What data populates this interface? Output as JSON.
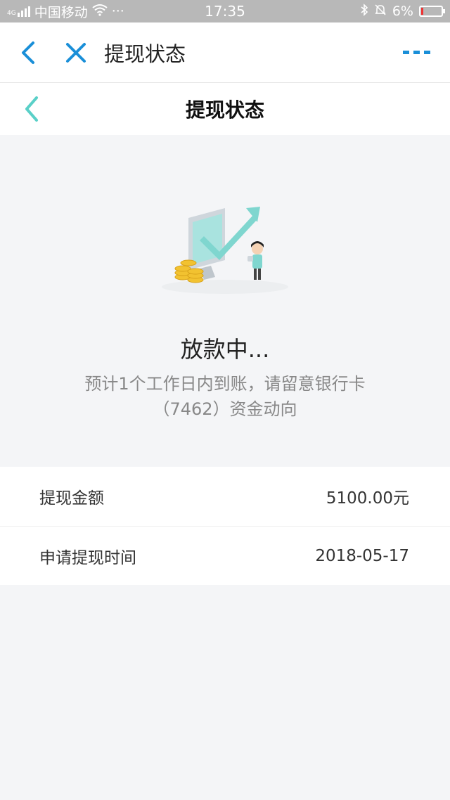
{
  "status_bar": {
    "carrier": "中国移动",
    "signal_label": "4G",
    "dots": "···",
    "time": "17:35",
    "battery": "6%"
  },
  "app_bar": {
    "title": "提现状态",
    "back_icon": "chevron-left-icon",
    "close_icon": "close-icon",
    "more_icon": "more-dots-icon",
    "accent_color": "#1a8fd8"
  },
  "page_nav": {
    "title": "提现状态",
    "back_icon": "chevron-left-icon",
    "back_color": "#5ad0c8"
  },
  "status": {
    "title": "放款中...",
    "desc_line1": "预计1个工作日内到账，请留意银行卡",
    "desc_line2": "（7462）资金动向"
  },
  "info": {
    "rows": [
      {
        "label": "提现金额",
        "value": "5100.00元"
      },
      {
        "label": "申请提现时间",
        "value": "2018-05-17"
      }
    ]
  }
}
